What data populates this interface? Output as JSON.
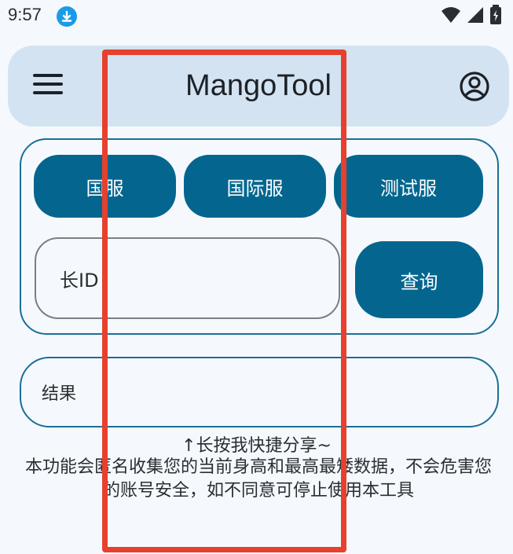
{
  "status_bar": {
    "time": "9:57",
    "icons": [
      "download-icon",
      "wifi-icon",
      "signal-icon",
      "battery-icon"
    ]
  },
  "app_bar": {
    "title": "MangoTool",
    "icons": [
      "menu-icon",
      "account-icon"
    ]
  },
  "servers": [
    {
      "label": "国服"
    },
    {
      "label": "国际服"
    },
    {
      "label": "测试服"
    }
  ],
  "id_input": {
    "placeholder": "长ID"
  },
  "query_button": {
    "label": "查询"
  },
  "result": {
    "label": "结果"
  },
  "share_hint": "↑长按我快捷分享~",
  "disclaimer": "本功能会匿名收集您的当前身高和最高最矮数据，不会危害您的账号安全，如不同意可停止使用本工具",
  "colors": {
    "primary": "#04668f",
    "outline": "#1a6f96",
    "app_bar_bg": "#d3e3f2",
    "background": "#f5f9fd",
    "annotation_red": "#e5412e"
  }
}
